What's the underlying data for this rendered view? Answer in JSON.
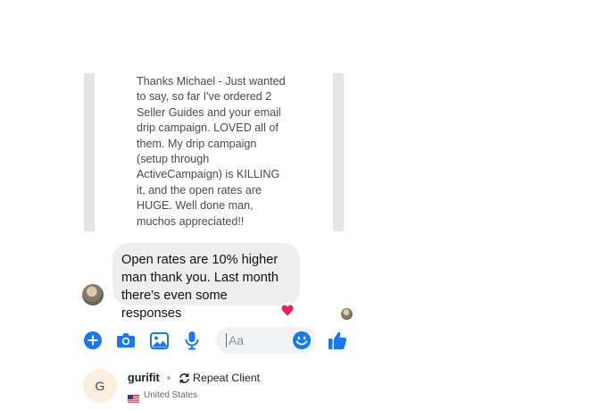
{
  "quote": {
    "text": "Thanks Michael - Just wanted\nto say, so far I've ordered 2\nSeller Guides and your email\ndrip campaign. LOVED all of\nthem. My drip campaign\n(setup through\nActiveCampaign) is KILLING\nit, and the open rates are\nHUGE. Well done man,\nmuchos appreciated!!"
  },
  "message": {
    "text": "Open rates are 10% higher\nman thank you. Last month\nthere's even some responses",
    "reaction": "heart-reaction"
  },
  "composer": {
    "placeholder": "Aa",
    "icons": [
      "plus-icon",
      "camera-icon",
      "image-icon",
      "microphone-icon",
      "emoji-icon",
      "thumbs-up-icon"
    ],
    "accent": "#1877f2"
  },
  "client": {
    "initial": "G",
    "name": "gurifit",
    "badge": "Repeat Client",
    "country": "United States"
  },
  "colors": {
    "bubble": "#eeeeee",
    "quote_bar": "#e4e4e4",
    "avatar_bg": "#fbeedd",
    "heart": "#e0245e"
  }
}
